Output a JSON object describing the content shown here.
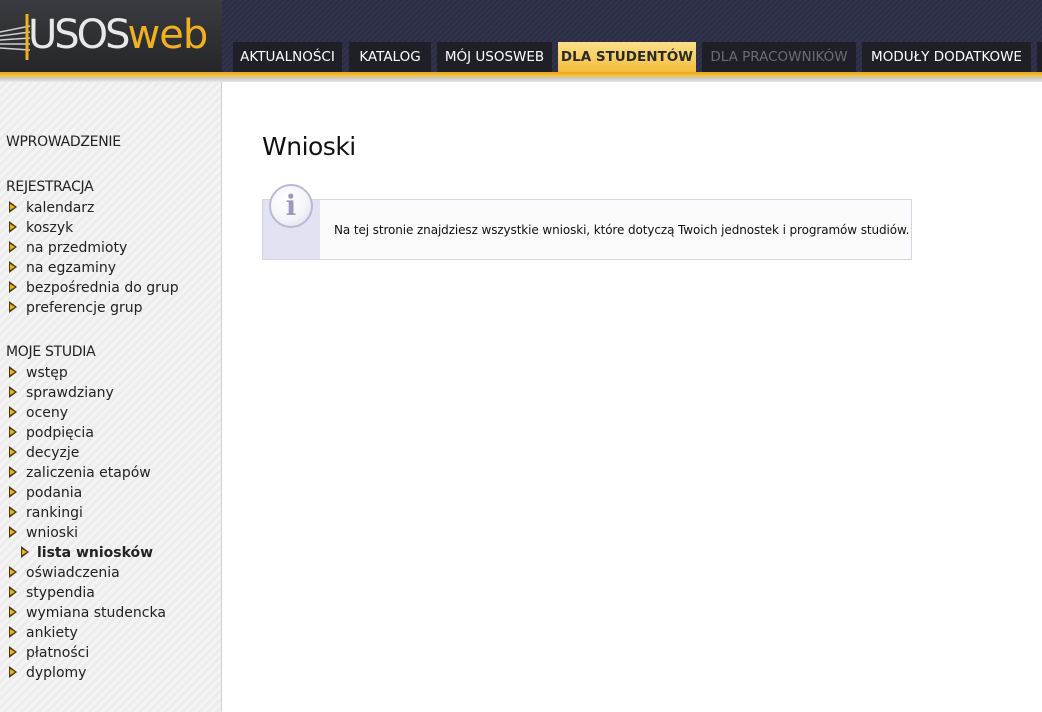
{
  "header": {
    "logo": {
      "part1": "USOS",
      "part2": "web"
    },
    "tabs": [
      {
        "label": "AKTUALNOŚCI",
        "state": "normal"
      },
      {
        "label": "KATALOG",
        "state": "normal"
      },
      {
        "label": "MÓJ USOSWEB",
        "state": "normal"
      },
      {
        "label": "DLA STUDENTÓW",
        "state": "active"
      },
      {
        "label": "DLA PRACOWNIKÓW",
        "state": "disabled"
      },
      {
        "label": "MODUŁY DODATKOWE",
        "state": "normal"
      }
    ]
  },
  "sidebar": {
    "intro": "WPROWADZENIE",
    "registration": {
      "title": "REJESTRACJA",
      "items": [
        "kalendarz",
        "koszyk",
        "na przedmioty",
        "na egzaminy",
        "bezpośrednia do grup",
        "preferencje grup"
      ]
    },
    "studies": {
      "title": "MOJE STUDIA",
      "items": [
        "wstęp",
        "sprawdziany",
        "oceny",
        "podpięcia",
        "decyzje",
        "zaliczenia etapów",
        "podania",
        "rankingi",
        "wnioski",
        "lista wniosków",
        "oświadczenia",
        "stypendia",
        "wymiana studencka",
        "ankiety",
        "płatności",
        "dyplomy"
      ]
    }
  },
  "main": {
    "title": "Wnioski",
    "info_text": "Na tej stronie znajdziesz wszystkie wnioski, które dotyczą Twoich jednostek i programów studiów.",
    "info_icon_char": "i"
  },
  "colors": {
    "accent": "#f3bd3c",
    "header_dark": "#2e3040",
    "tab_bg": "#1f2027",
    "info_strip": "#e2e2f2"
  },
  "icons": {
    "info": "info-icon",
    "menu_bullet": "arrow-bullet-icon"
  }
}
